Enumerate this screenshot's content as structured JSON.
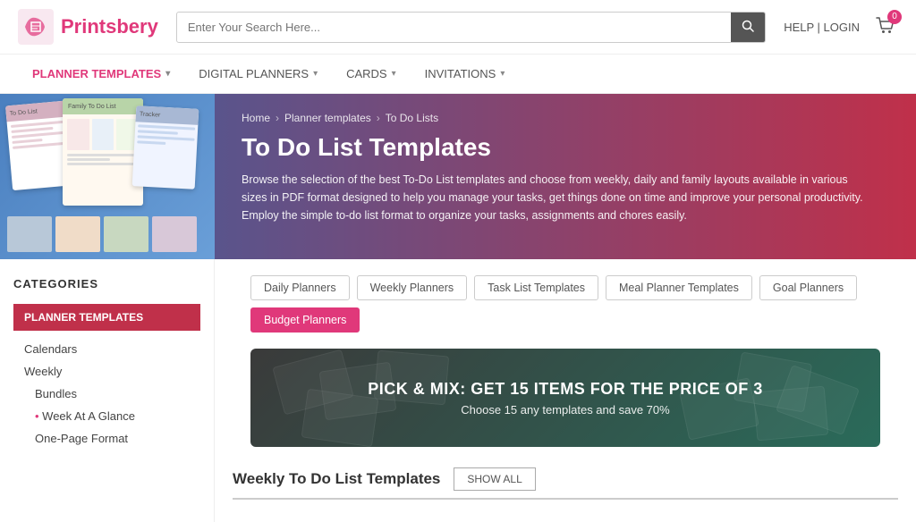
{
  "header": {
    "logo_text": "Printsbery",
    "search_placeholder": "Enter Your Search Here...",
    "help_login": "HELP | LOGIN",
    "cart_count": "0"
  },
  "nav": {
    "items": [
      {
        "label": "PLANNER TEMPLATES",
        "active": true,
        "has_dropdown": true
      },
      {
        "label": "DIGITAL PLANNERS",
        "active": false,
        "has_dropdown": true
      },
      {
        "label": "CARDS",
        "active": false,
        "has_dropdown": true
      },
      {
        "label": "INVITATIONS",
        "active": false,
        "has_dropdown": true
      }
    ]
  },
  "breadcrumb": {
    "items": [
      "Home",
      "Planner templates",
      "To Do Lists"
    ]
  },
  "hero": {
    "title": "To Do List Templates",
    "description": "Browse the selection of the best To-Do List templates and choose from weekly, daily and family layouts available in various sizes in PDF format designed to help you manage your tasks, get things done on time and improve your personal productivity. Employ the simple to-do list format to organize your tasks, assignments and chores easily."
  },
  "filters": {
    "tags": [
      {
        "label": "Daily Planners",
        "active": false
      },
      {
        "label": "Weekly Planners",
        "active": false
      },
      {
        "label": "Task List Templates",
        "active": false
      },
      {
        "label": "Meal Planner Templates",
        "active": false
      },
      {
        "label": "Goal Planners",
        "active": false
      },
      {
        "label": "Budget Planners",
        "active": true
      }
    ]
  },
  "promo": {
    "main": "PICK & MIX: GET 15 ITEMS FOR THE PRICE OF 3",
    "sub": "Choose 15 any templates and save 70%"
  },
  "sidebar": {
    "title": "CATEGORIES",
    "section_title": "PLANNER TEMPLATES",
    "items": [
      {
        "label": "Calendars",
        "level": 1
      },
      {
        "label": "Weekly",
        "level": 1
      },
      {
        "label": "Bundles",
        "level": 2
      },
      {
        "label": "Week At A Glance",
        "level": 3
      },
      {
        "label": "One-Page Format",
        "level": 2
      }
    ]
  },
  "weekly_section": {
    "title": "Weekly To Do List Templates",
    "show_all": "SHOW ALL"
  }
}
